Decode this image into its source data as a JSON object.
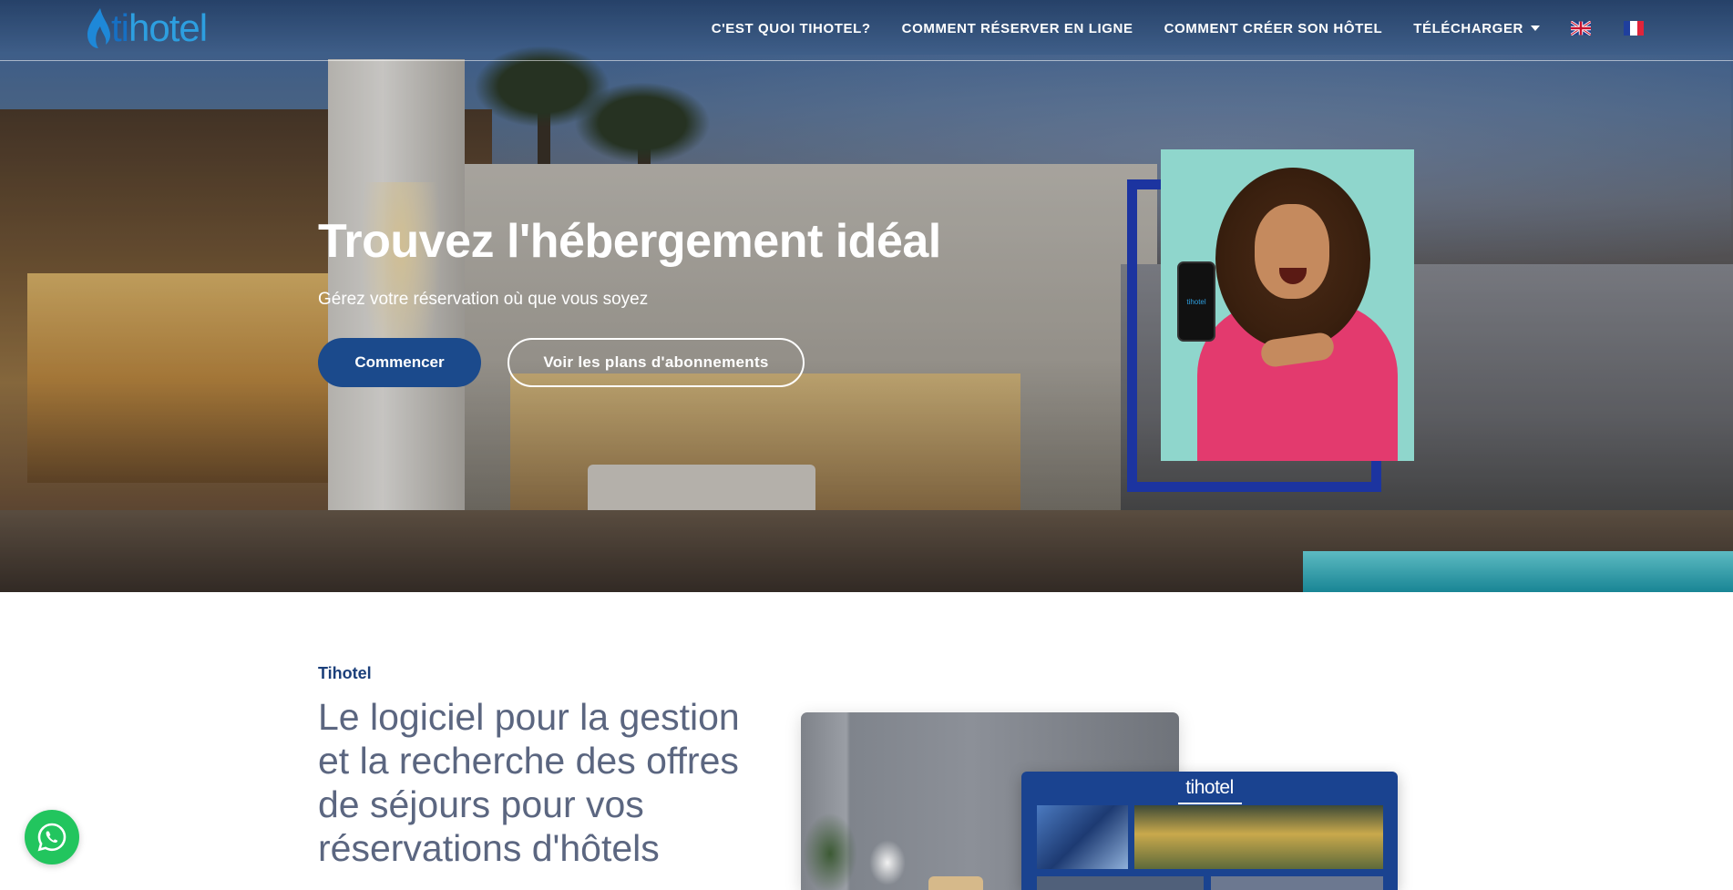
{
  "brand": {
    "logo_text_ti": "ti",
    "logo_text_hotel": "hotel",
    "primary_color": "#1b4a8c",
    "accent_color": "#2d9fe0"
  },
  "nav": {
    "items": [
      {
        "label": "C'EST QUOI TIHOTEL?"
      },
      {
        "label": "COMMENT RÉSERVER EN LIGNE"
      },
      {
        "label": "COMMENT CRÉER SON HÔTEL"
      },
      {
        "label": "TÉLÉCHARGER"
      }
    ],
    "languages": [
      "en-flag-icon",
      "fr-flag-icon"
    ]
  },
  "hero": {
    "title": "Trouvez l'hébergement idéal",
    "subtitle": "Gérez votre réservation où que vous soyez",
    "primary_button": "Commencer",
    "secondary_button": "Voir les plans d'abonnements",
    "phone_logo": "tihotel"
  },
  "section": {
    "eyebrow": "Tihotel",
    "heading": "Le logiciel pour la gestion et la recherche des offres de séjours pour vos réservations d'hôtels",
    "card_logo": "tihotel"
  },
  "floating": {
    "whatsapp_icon": "whatsapp-icon"
  }
}
